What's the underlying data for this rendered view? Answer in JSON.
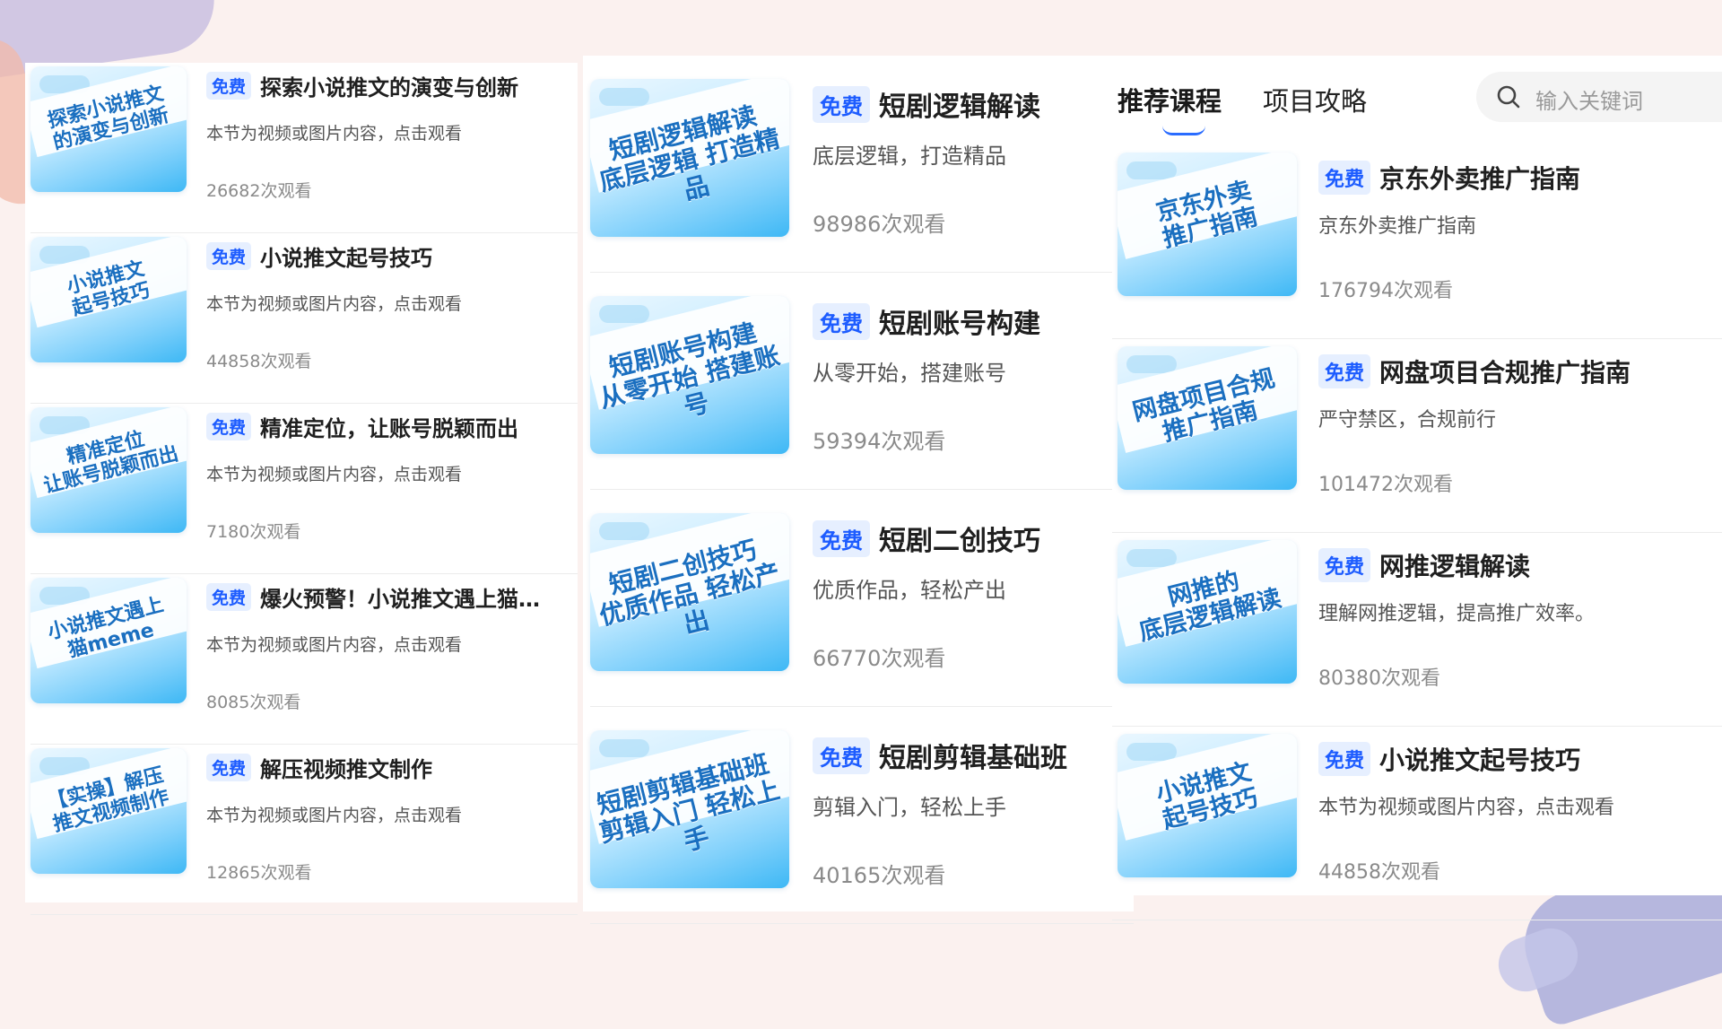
{
  "free_tag": "免费",
  "tabs": [
    "推荐课程",
    "项目攻略"
  ],
  "search": {
    "placeholder": "输入关键词"
  },
  "col1": [
    {
      "cover": "探索小说推文\n的演变与创新",
      "title": "探索小说推文的演变与创新",
      "desc": "本节为视频或图片内容，点击观看",
      "views": "26682次观看"
    },
    {
      "cover": "小说推文\n起号技巧",
      "title": "小说推文起号技巧",
      "desc": "本节为视频或图片内容，点击观看",
      "views": "44858次观看"
    },
    {
      "cover": "精准定位\n让账号脱颖而出",
      "title": "精准定位，让账号脱颖而出",
      "desc": "本节为视频或图片内容，点击观看",
      "views": "7180次观看"
    },
    {
      "cover": "小说推文遇上\n猫meme",
      "title": "爆火预警！小说推文遇上猫…",
      "desc": "本节为视频或图片内容，点击观看",
      "views": "8085次观看"
    },
    {
      "cover": "【实操】解压\n推文视频制作",
      "title": "解压视频推文制作",
      "desc": "本节为视频或图片内容，点击观看",
      "views": "12865次观看"
    }
  ],
  "col2": [
    {
      "cover": "短剧逻辑解读\n底层逻辑 打造精品",
      "title": "短剧逻辑解读",
      "desc": "底层逻辑，打造精品",
      "views": "98986次观看"
    },
    {
      "cover": "短剧账号构建\n从零开始 搭建账号",
      "title": "短剧账号构建",
      "desc": "从零开始，搭建账号",
      "views": "59394次观看"
    },
    {
      "cover": "短剧二创技巧\n优质作品 轻松产出",
      "title": "短剧二创技巧",
      "desc": "优质作品，轻松产出",
      "views": "66770次观看"
    },
    {
      "cover": "短剧剪辑基础班\n剪辑入门 轻松上手",
      "title": "短剧剪辑基础班",
      "desc": "剪辑入门，轻松上手",
      "views": "40165次观看"
    }
  ],
  "col3": [
    {
      "cover": "京东外卖\n推广指南",
      "title": "京东外卖推广指南",
      "desc": "京东外卖推广指南",
      "views": "176794次观看"
    },
    {
      "cover": "网盘项目合规\n推广指南",
      "title": "网盘项目合规推广指南",
      "desc": "严守禁区，合规前行",
      "views": "101472次观看"
    },
    {
      "cover": "网推的\n底层逻辑解读",
      "title": "网推逻辑解读",
      "desc": "理解网推逻辑，提高推广效率。",
      "views": "80380次观看"
    },
    {
      "cover": "小说推文\n起号技巧",
      "title": "小说推文起号技巧",
      "desc": "本节为视频或图片内容，点击观看",
      "views": "44858次观看"
    }
  ],
  "colors": {
    "accent": "#1d5cff",
    "tag_bg": "#e6efff",
    "thumb_blue": "#3eb8f5"
  },
  "icons": {
    "search": "search-icon"
  }
}
